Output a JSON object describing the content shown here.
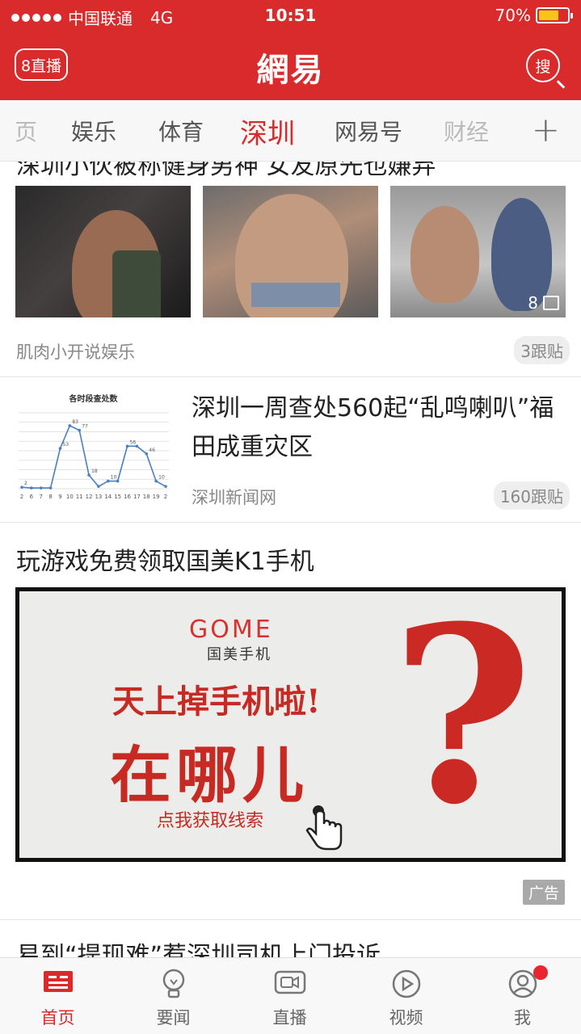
{
  "status_bar": {
    "carrier": "中国联通",
    "network": "4G",
    "time": "10:51",
    "battery": "70%",
    "battery_level": 0.7
  },
  "header": {
    "live_label": "8直播",
    "logo": "網易",
    "search_label": "搜"
  },
  "tabs": {
    "items": [
      {
        "label": "页",
        "state": "faded"
      },
      {
        "label": "娱乐",
        "state": "normal"
      },
      {
        "label": "体育",
        "state": "normal"
      },
      {
        "label": "深圳",
        "state": "active"
      },
      {
        "label": "网易号",
        "state": "normal"
      },
      {
        "label": "财经",
        "state": "faded"
      }
    ],
    "add_label": "+"
  },
  "feed": {
    "peek_title": "深圳小伙被称健身男神 女友原先也嫌弃",
    "photo_post": {
      "image_count": "8",
      "source": "肌肉小开说娱乐",
      "replies": "3跟贴"
    },
    "news_item": {
      "title": "深圳一周查处560起“乱鸣喇叭”福田成重灾区",
      "source": "深圳新闻网",
      "replies": "160跟贴",
      "chart_data": {
        "type": "line",
        "title": "各时段查处数",
        "categories": [
          "2",
          "6",
          "7",
          "8",
          "9",
          "10",
          "11",
          "12",
          "13",
          "14",
          "15",
          "16",
          "17",
          "18",
          "19",
          "2"
        ],
        "values": [
          2,
          1,
          1,
          1,
          53,
          83,
          77,
          18,
          3,
          10,
          10,
          56,
          56,
          46,
          10,
          3
        ],
        "data_labels": [
          "2",
          "53",
          "83",
          "77",
          "18",
          "10",
          "56",
          "46",
          "10"
        ],
        "grid": true
      }
    },
    "ad": {
      "title": "玩游戏免费领取国美K1手机",
      "brand": "GOME",
      "brand_sub": "国美手机",
      "line1": "天上掉手机啦!",
      "line2": "在哪儿",
      "line3": "点我获取线索",
      "question_mark": "?",
      "tag": "广告"
    },
    "last_title": "易到“提现难”惹深圳司机上门投诉"
  },
  "bottom_nav": {
    "items": [
      {
        "label": "首页",
        "icon": "home-news-icon",
        "active": true
      },
      {
        "label": "要闻",
        "icon": "bulb-icon",
        "active": false
      },
      {
        "label": "直播",
        "icon": "camera-icon",
        "active": false
      },
      {
        "label": "视频",
        "icon": "play-icon",
        "active": false
      },
      {
        "label": "我",
        "icon": "user-icon",
        "active": false
      }
    ]
  },
  "colors": {
    "brand_red": "#d92b2b",
    "accent_ad_red": "#c62a22"
  }
}
